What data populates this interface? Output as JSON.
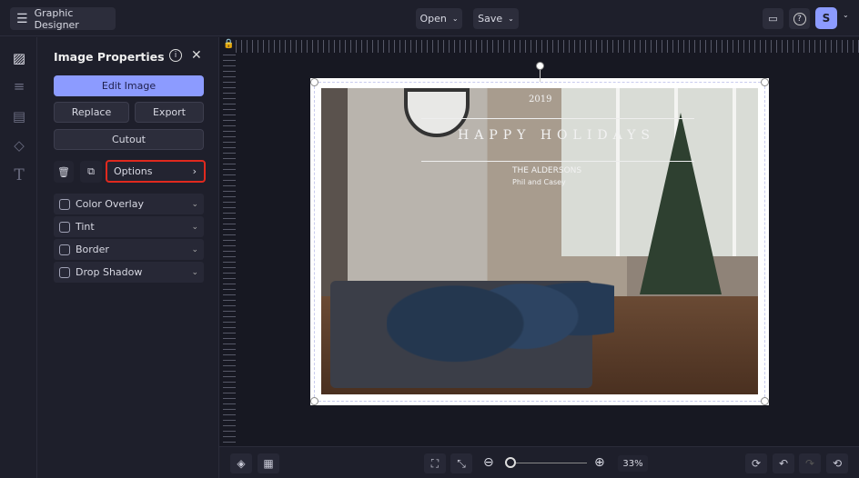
{
  "topbar": {
    "app_title": "Graphic Designer",
    "open_label": "Open",
    "save_label": "Save",
    "avatar_initial": "S",
    "avatar_color": "#8c9bff"
  },
  "panel": {
    "title": "Image Properties",
    "edit_image": "Edit Image",
    "replace": "Replace",
    "export": "Export",
    "cutout": "Cutout",
    "options": "Options",
    "accordions": [
      {
        "label": "Color Overlay",
        "checked": false
      },
      {
        "label": "Tint",
        "checked": false
      },
      {
        "label": "Border",
        "checked": false
      },
      {
        "label": "Drop Shadow",
        "checked": false
      }
    ]
  },
  "canvas": {
    "card_year": "2019",
    "card_title": "HAPPY HOLIDAYS",
    "card_family": "THE ALDERSONS",
    "card_names": "Phil and Casey"
  },
  "bottombar": {
    "zoom_level": "33%",
    "zoom_fraction": 0.03
  },
  "colors": {
    "accent": "#8c9bff",
    "highlight": "#e0291e",
    "background": "#1e1f2b"
  }
}
